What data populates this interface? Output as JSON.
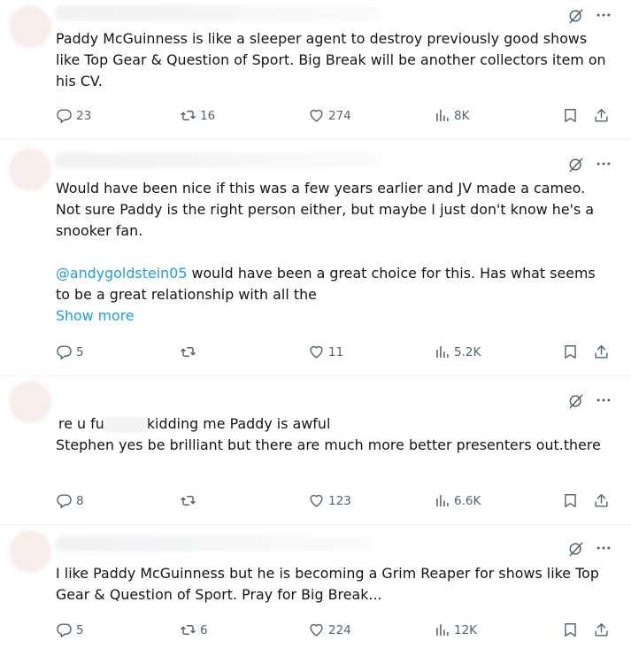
{
  "tweets": [
    {
      "text": "Paddy McGuinness is like a sleeper agent to destroy previously good shows like Top Gear & Question of Sport. Big Break will be another collectors item on his CV.",
      "replies": "23",
      "reposts": "16",
      "likes": "274",
      "views": "8K"
    },
    {
      "text": "Would have been nice if this was a few years earlier and JV made a cameo. Not sure Paddy is the right person either, but maybe I just don't know he's a snooker fan.",
      "mention": "@andygoldstein05",
      "text_after_mention": " would have been a great choice for this. Has what seems to be a great relationship with all the",
      "show_more": "Show more",
      "replies": "5",
      "reposts": "",
      "likes": "11",
      "views": "5.2K"
    },
    {
      "text_part1": "re u fu",
      "text_part2": "kidding me Paddy is awful",
      "text_line2": "Stephen yes be brilliant but there are much more better presenters out.there",
      "replies": "8",
      "reposts": "",
      "likes": "123",
      "views": "6.6K"
    },
    {
      "text": "I like Paddy McGuinness but he is becoming a Grim Reaper for shows like Top Gear & Question of Sport. Pray for Big Break...",
      "replies": "5",
      "reposts": "6",
      "likes": "224",
      "views": "12K"
    }
  ],
  "colors": {
    "text": "#0f1419",
    "muted": "#536471",
    "link": "#1d9bf0",
    "divider": "#eff3f4"
  },
  "icons": [
    "grok-icon",
    "more-icon",
    "reply-icon",
    "repost-icon",
    "like-icon",
    "views-icon",
    "bookmark-icon",
    "share-icon"
  ]
}
